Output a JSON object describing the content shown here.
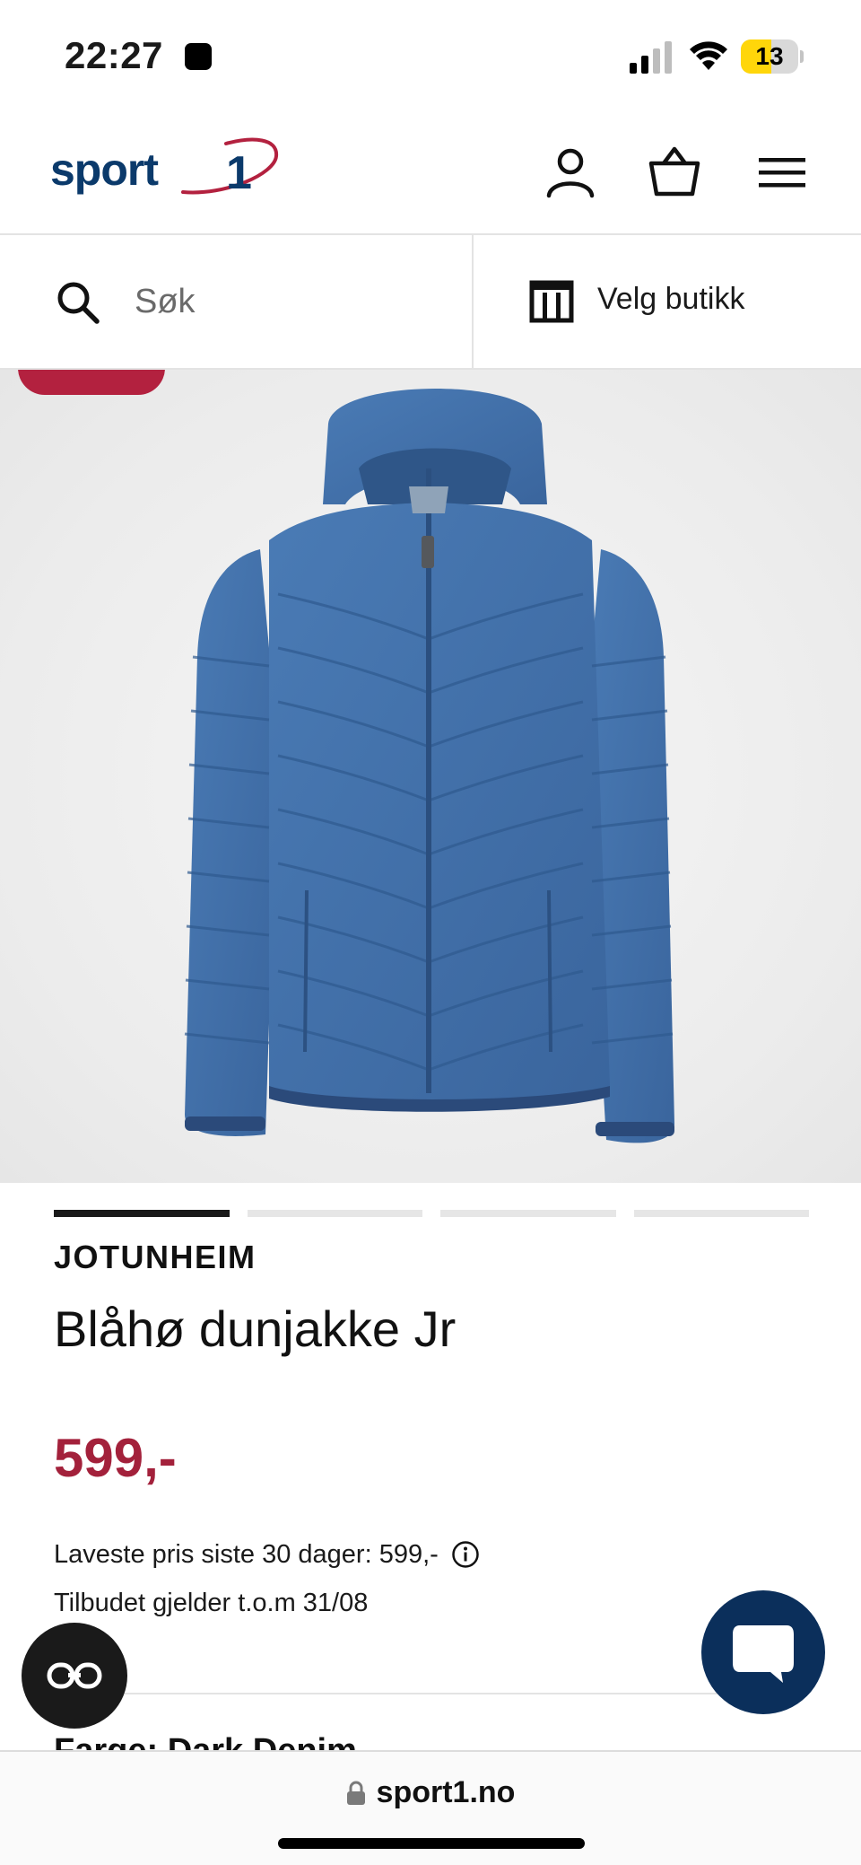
{
  "status_bar": {
    "time": "22:27",
    "battery": "13"
  },
  "header": {
    "logo_text": "sport 1",
    "icons": [
      "account-icon",
      "basket-icon",
      "menu-icon"
    ]
  },
  "search": {
    "placeholder": "Søk",
    "store_label": "Velg butikk"
  },
  "gallery": {
    "image_count": 4,
    "active_index": 0
  },
  "product": {
    "brand": "JOTUNHEIM",
    "title": "Blåhø dunjakke Jr",
    "price": "599,-",
    "lowest_price_text": "Laveste pris siste 30 dager: 599,-",
    "offer_text": "Tilbudet gjelder t.o.m 31/08",
    "color_label": "Farge: Dark Denim"
  },
  "browser": {
    "url": "sport1.no"
  },
  "colors": {
    "brand_blue": "#0b3a6b",
    "brand_red": "#b3213f",
    "price_red": "#a3213b",
    "jacket_blue": "#3f6fa8"
  }
}
